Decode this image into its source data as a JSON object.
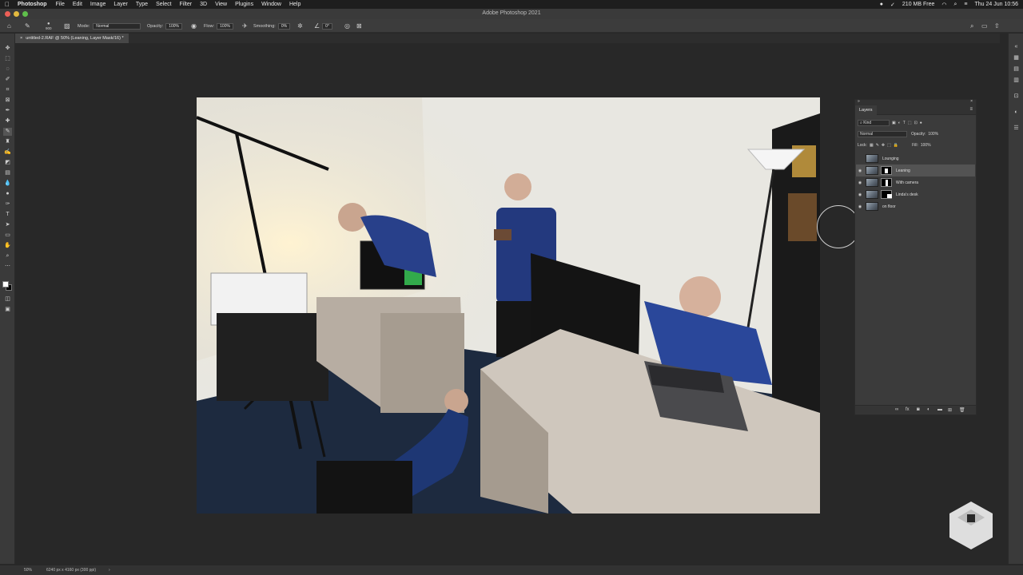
{
  "menubar": {
    "app": "Photoshop",
    "items": [
      "File",
      "Edit",
      "Image",
      "Layer",
      "Type",
      "Select",
      "Filter",
      "3D",
      "View",
      "Plugins",
      "Window",
      "Help"
    ],
    "memory": "210 MB Free",
    "datetime": "Thu 24 Jun  10:56"
  },
  "window": {
    "title": "Adobe Photoshop 2021"
  },
  "options": {
    "brush_size": "900",
    "mode_label": "Mode:",
    "mode": "Normal",
    "opacity_label": "Opacity:",
    "opacity": "100%",
    "flow_label": "Flow:",
    "flow": "100%",
    "smoothing_label": "Smoothing:",
    "smoothing": "0%",
    "angle": "0°"
  },
  "document": {
    "tab": "untitled-2.RAF @ 50% (Leaning, Layer Mask/16) *",
    "close": "×"
  },
  "layers_panel": {
    "tab": "Layers",
    "filter_kind": "Kind",
    "blend_mode": "Normal",
    "opacity_label": "Opacity:",
    "opacity": "100%",
    "lock_label": "Lock:",
    "fill_label": "Fill:",
    "fill": "100%",
    "layers": [
      {
        "name": "Lounging",
        "visible": false,
        "selected": false,
        "mask": false
      },
      {
        "name": "Leaning",
        "visible": true,
        "selected": true,
        "mask": true
      },
      {
        "name": "With camera",
        "visible": true,
        "selected": false,
        "mask": true
      },
      {
        "name": "Linda's desk",
        "visible": true,
        "selected": false,
        "mask": true
      },
      {
        "name": "on floor",
        "visible": true,
        "selected": false,
        "mask": false
      }
    ]
  },
  "status": {
    "zoom": "50%",
    "doc_size": "6240 px x 4160 px (300 ppi)"
  }
}
